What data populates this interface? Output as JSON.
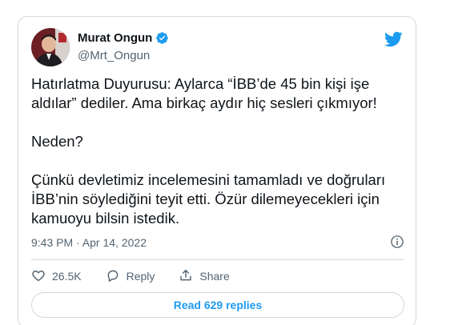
{
  "tweet": {
    "display_name": "Murat Ongun",
    "handle": "@Mrt_Ongun",
    "text": "Hatırlatma Duyurusu: Aylarca “İBB’de 45 bin kişi işe aldılar” dediler. Ama birkaç aydır hiç sesleri çıkmıyor!\n\nNeden?\n\nÇünkü devletimiz incelemesini tamamladı ve doğruları İBB’nin söylediğini teyit etti. Özür dilemeyecekleri için kamuoyu bilsin istedik.",
    "timestamp": "9:43 PM · Apr 14, 2022"
  },
  "actions": {
    "like_count": "26.5K",
    "reply_label": "Reply",
    "share_label": "Share"
  },
  "read_replies_label": "Read 629 replies",
  "icons": {
    "verified": "verified-badge-icon",
    "brand": "twitter-bird-icon",
    "info": "info-icon",
    "like": "heart-icon",
    "reply": "reply-bubble-icon",
    "share": "share-upload-icon"
  },
  "colors": {
    "accent": "#1d9bf0",
    "text": "#0f1419",
    "secondary": "#536471",
    "border": "#cfd9de"
  }
}
